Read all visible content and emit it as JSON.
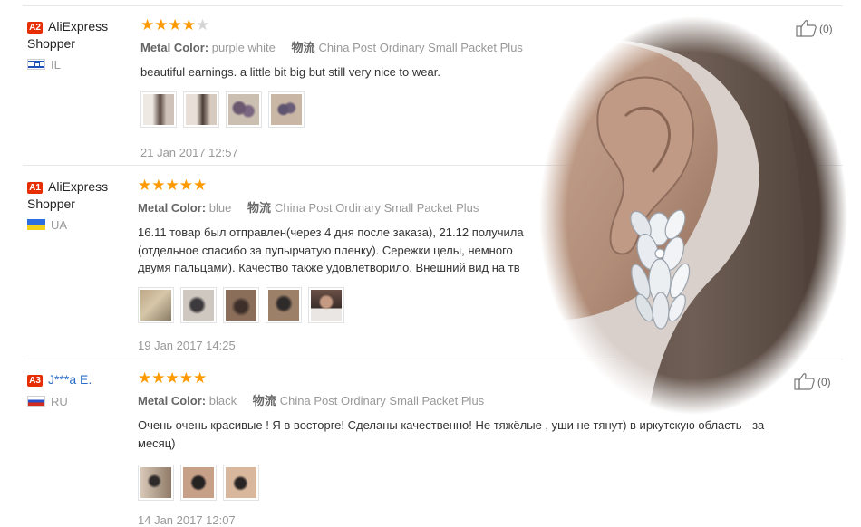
{
  "reviews": [
    {
      "badge": "A2",
      "name_line1": "AliExpress",
      "name_line2": "Shopper",
      "country": "IL",
      "rating": 4,
      "meta_label": "Metal Color:",
      "meta_value": "purple white",
      "ship_label": "物流",
      "ship_value": "China Post Ordinary Small Packet Plus",
      "text": "beautiful earnings. a little bit big but still very nice to wear.",
      "date": "21 Jan 2017 12:57",
      "helpful": "(0)"
    },
    {
      "badge": "A1",
      "name_line1": "AliExpress",
      "name_line2": "Shopper",
      "country": "UA",
      "rating": 5,
      "meta_label": "Metal Color:",
      "meta_value": "blue",
      "ship_label": "物流",
      "ship_value": "China Post Ordinary Small Packet Plus",
      "text_lines": [
        "16.11 товар был отправлен(через 4 дня после заказа), 21.12 получила",
        "(отдельное спасибо за пупырчатую пленку). Сережки целы, немного",
        "двумя пальцами). Качество также удовлетворило. Внешний вид на тв"
      ],
      "date": "19 Jan 2017 14:25"
    },
    {
      "badge": "A3",
      "name_line1": "J***a E.",
      "country": "RU",
      "rating": 5,
      "meta_label": "Metal Color:",
      "meta_value": "black",
      "ship_label": "物流",
      "ship_value": "China Post Ordinary Small Packet Plus",
      "text_lines": [
        "Очень очень красивые ! Я в восторге! Сделаны качественно! Не тяжёлые , уши не тянут) в иркутскую область - за",
        "месяц)"
      ],
      "date": "14 Jan 2017 12:07",
      "helpful": "(0)"
    }
  ],
  "icons": {
    "thumbs_up": "thumbs-up-icon",
    "star": "star-icon"
  },
  "colors": {
    "star": "#ff9900",
    "badge": "#e62e04",
    "link": "#2a6cc7"
  }
}
